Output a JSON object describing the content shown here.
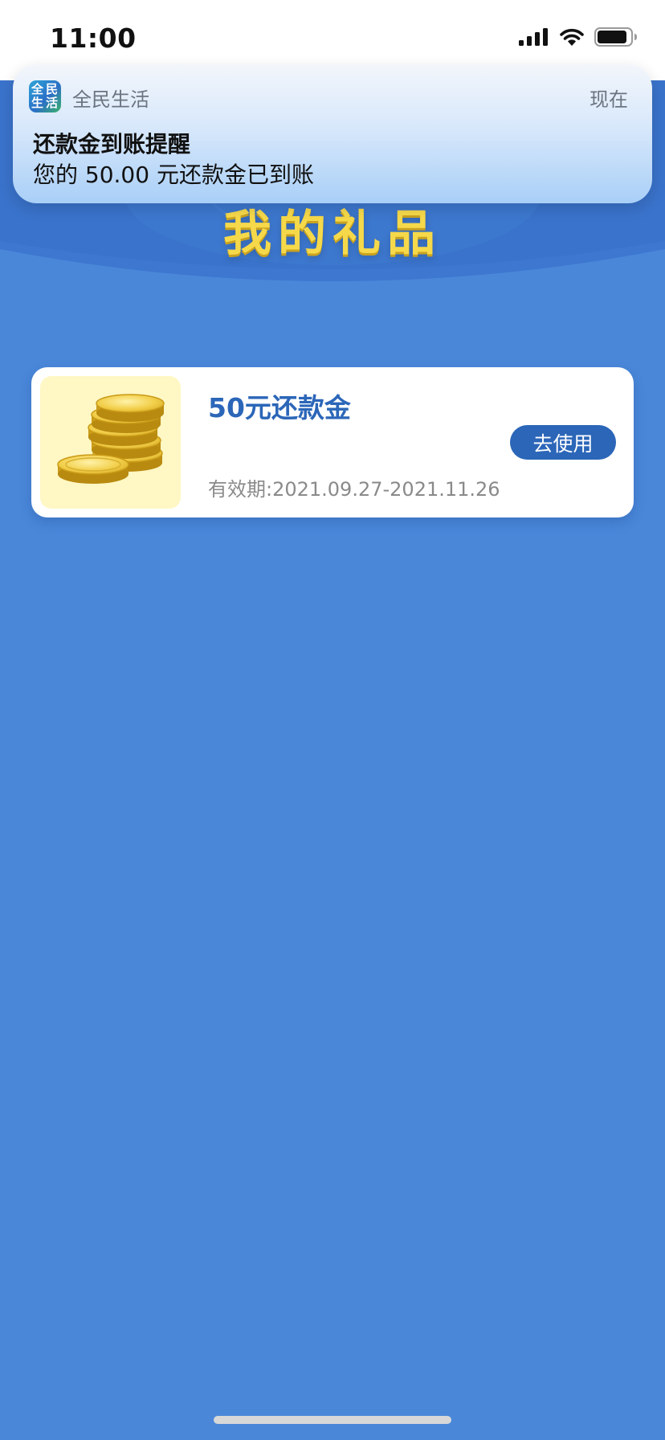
{
  "status_bar": {
    "time": "11:00",
    "icons": [
      "signal-icon",
      "wifi-icon",
      "battery-icon"
    ]
  },
  "notification": {
    "app_icon_text": [
      "全",
      "民",
      "生",
      "活"
    ],
    "app_name": "全民生活",
    "time": "现在",
    "title": "还款金到账提醒",
    "body": "您的 50.00 元还款金已到账"
  },
  "page": {
    "title": "我的礼品"
  },
  "gift": {
    "name": "50元还款金",
    "validity": "有效期:2021.09.27-2021.11.26",
    "use_button": "去使用",
    "thumb_icon": "gold-coins-icon"
  },
  "colors": {
    "background": "#4a87d9",
    "header_dark": "#3d77cf",
    "title_yellow": "#f6d94a",
    "accent_blue": "#2b66b8",
    "coin_bg": "#fff7c4"
  }
}
